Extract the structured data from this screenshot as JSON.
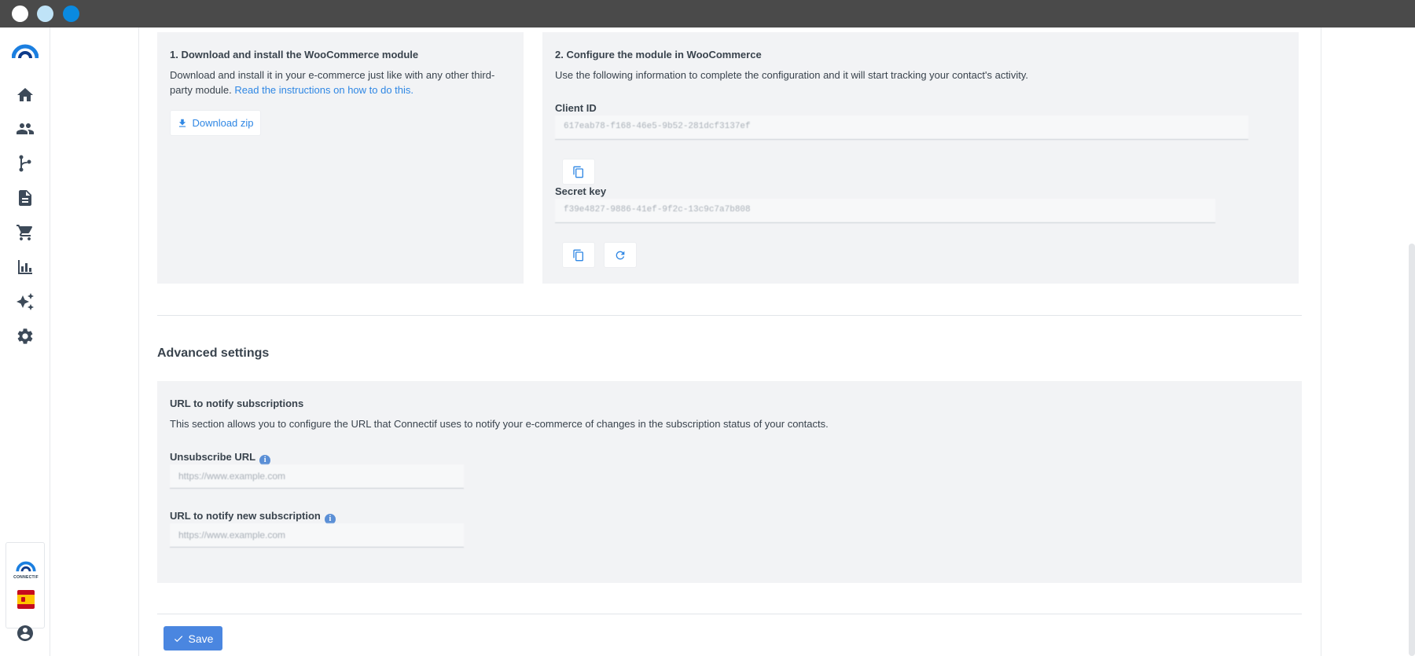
{
  "window": {
    "buttons": [
      "close",
      "minimize",
      "maximize"
    ]
  },
  "sidebar": {
    "logo": "connectif-arc-logo",
    "items": [
      {
        "icon": "home-icon"
      },
      {
        "icon": "contacts-icon"
      },
      {
        "icon": "workflows-icon"
      },
      {
        "icon": "content-icon"
      },
      {
        "icon": "cart-icon"
      },
      {
        "icon": "reports-icon"
      },
      {
        "icon": "sparkle-icon"
      },
      {
        "icon": "gear-icon"
      }
    ],
    "brand": {
      "name": "CONNECTIF",
      "flag": "spain-flag"
    },
    "profile_icon": "account-circle-icon"
  },
  "step1": {
    "title": "1. Download and install the WooCommerce module",
    "description": "Download and install it in your e-commerce just like with any other third-party module.",
    "link": "Read the instructions on how to do this.",
    "download_label": "Download zip"
  },
  "step2": {
    "title": "2. Configure the module in WooCommerce",
    "description": "Use the following information to complete the configuration and it will start tracking your contact's activity.",
    "client_id_label": "Client ID",
    "client_id_value": "617eab78-f168-46e5-9b52-281dcf3137ef",
    "secret_key_label": "Secret key",
    "secret_key_value": "f39e4827-9886-41ef-9f2c-13c9c7a7b808"
  },
  "advanced": {
    "title": "Advanced settings",
    "subtitle": "URL to notify subscriptions",
    "description": "This section allows you to configure the URL that Connectif uses to notify your e-commerce of changes in the subscription status of your contacts.",
    "unsubscribe_label": "Unsubscribe URL",
    "unsubscribe_placeholder": "https://www.example.com",
    "subscribe_label": "URL to notify new subscription",
    "subscribe_placeholder": "https://www.example.com"
  },
  "actions": {
    "save_label": "Save"
  },
  "colors": {
    "accent": "#2f87e4",
    "save": "#4a86e0",
    "panel": "#f2f3f5"
  }
}
